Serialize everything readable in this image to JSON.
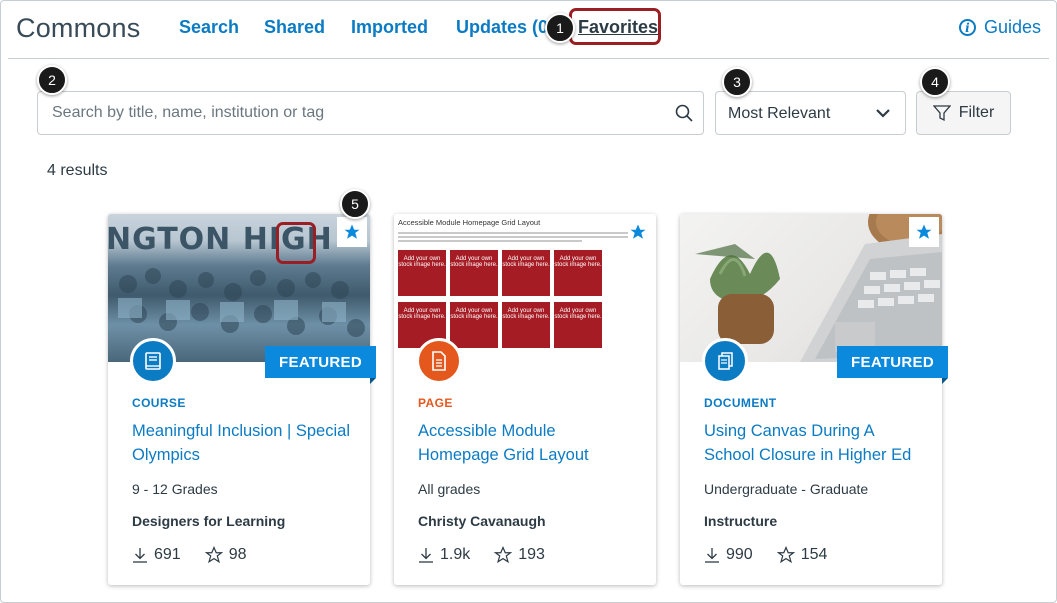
{
  "header": {
    "app_title": "Commons",
    "nav": [
      "Search",
      "Shared",
      "Imported",
      "Updates (0",
      "Favorites"
    ],
    "guides_label": "Guides"
  },
  "callouts": [
    "1",
    "2",
    "3",
    "4",
    "5"
  ],
  "search": {
    "placeholder": "Search by title, name, institution or tag",
    "value": ""
  },
  "sort": {
    "selected": "Most Relevant"
  },
  "filter_label": "Filter",
  "results_count": "4 results",
  "page_preview": {
    "title": "Accessible Module Homepage Grid Layout",
    "tile_text": "Add your own stock image here."
  },
  "cards": [
    {
      "image": "crowd-photo",
      "crowd_text": "NGTON HIGH",
      "featured": "FEATURED",
      "type": "COURSE",
      "type_color": "#0b7bc4",
      "title": "Meaningful Inclusion | Special Olympics",
      "grades": "9 - 12 Grades",
      "author": "Designers for Learning",
      "downloads": "691",
      "favorites": "98"
    },
    {
      "image": "page-preview",
      "featured": "",
      "type": "PAGE",
      "type_color": "#e5581d",
      "title": "Accessible Module Homepage Grid Layout",
      "grades": "All grades",
      "author": "Christy Cavanaugh",
      "downloads": "1.9k",
      "favorites": "193"
    },
    {
      "image": "desk-photo",
      "featured": "FEATURED",
      "type": "DOCUMENT",
      "type_color": "#0b7bc4",
      "title": "Using Canvas During A School Closure in Higher Ed",
      "grades": "Undergraduate - Graduate",
      "author": "Instructure",
      "downloads": "990",
      "favorites": "154"
    }
  ],
  "colors": {
    "link": "#0b7bc4",
    "featured": "#0b89dc",
    "highlight": "#9a1f24",
    "page_orange": "#e5581d"
  }
}
